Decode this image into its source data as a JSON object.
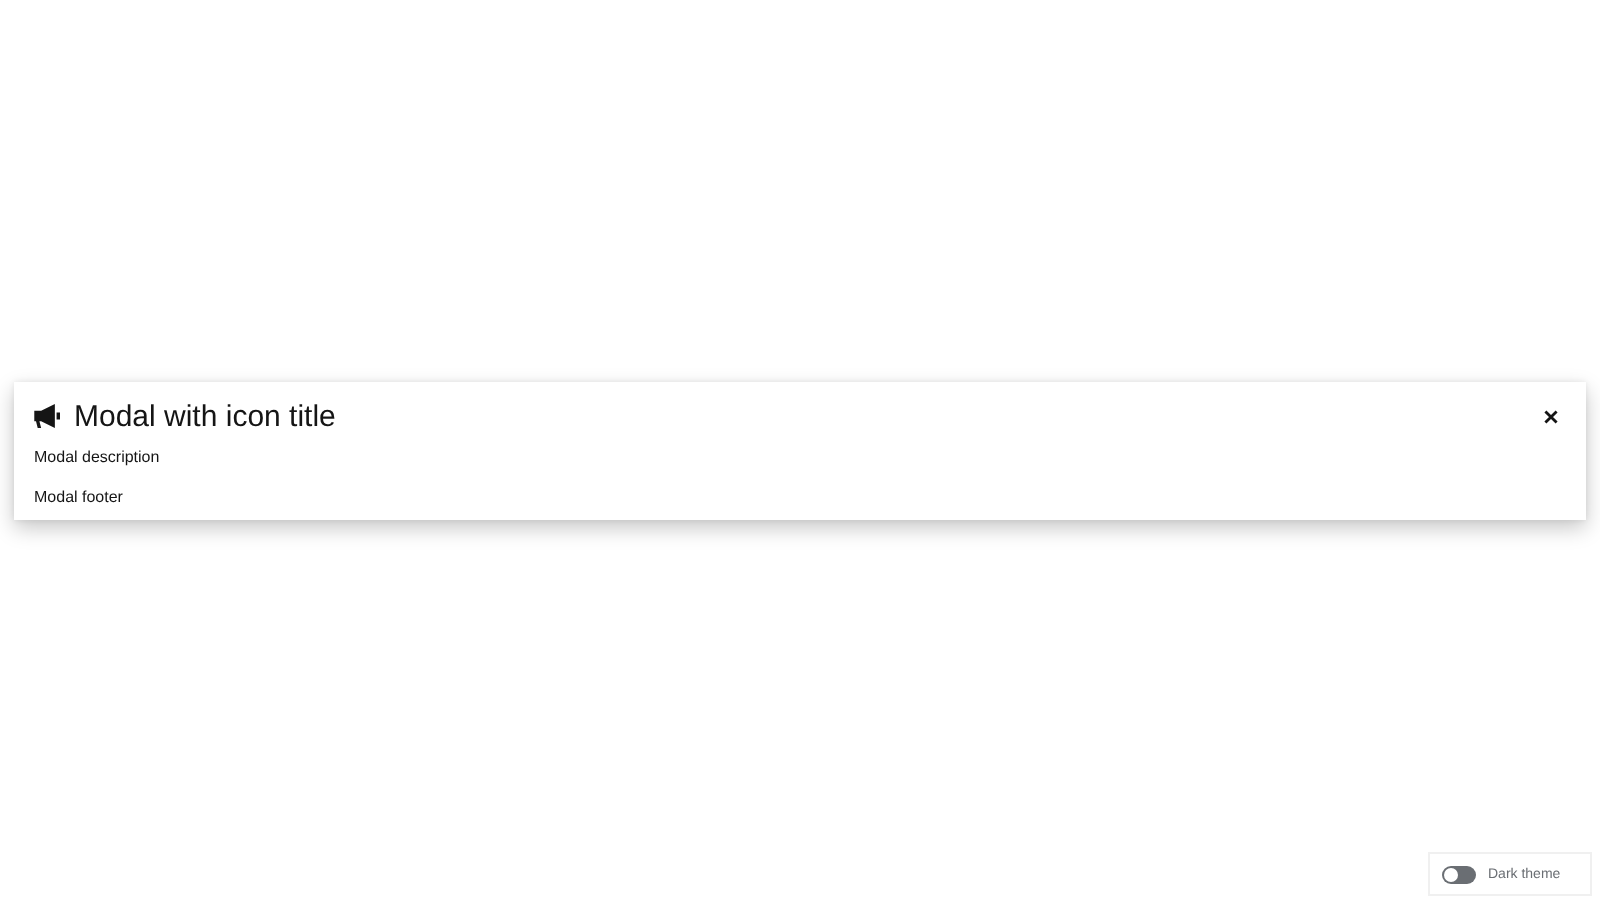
{
  "modal": {
    "title": "Modal with icon title",
    "description": "Modal description",
    "footer": "Modal footer"
  },
  "theme_switch": {
    "label": "Dark theme",
    "on": false
  }
}
